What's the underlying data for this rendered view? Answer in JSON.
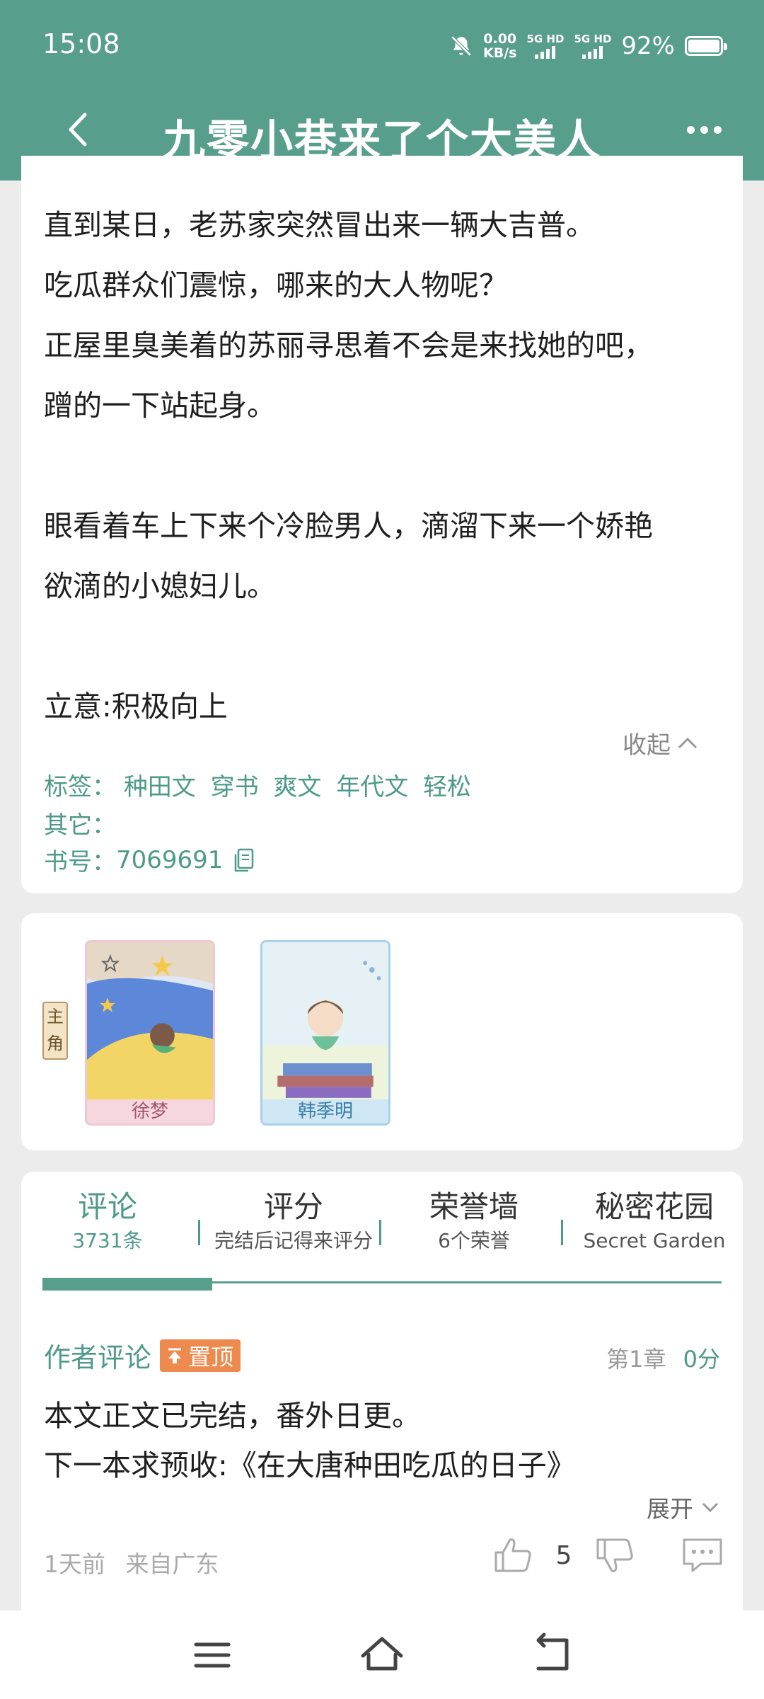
{
  "status_bar": {
    "time": "15:08",
    "net_speed_value": "0.00",
    "net_speed_unit": "KB/s",
    "sim1_label": "5G HD",
    "sim2_label": "5G HD",
    "battery": "92%"
  },
  "header": {
    "title": "九零小巷来了个大美人",
    "back_icon": "chevron-left-icon",
    "more_icon": "more-dots-icon"
  },
  "intro": {
    "lines": [
      "直到某日，老苏家突然冒出来一辆大吉普。",
      "吃瓜群众们震惊，哪来的大人物呢？",
      "正屋里臭美着的苏丽寻思着不会是来找她的吧，",
      "蹭的一下站起身。",
      "",
      "眼看着车上下来个冷脸男人，滴溜下来一个娇艳",
      "欲滴的小媳妇儿。",
      "",
      "立意:积极向上"
    ],
    "collapse_label": "收起",
    "tags_label": "标签：",
    "tags": [
      "种田文",
      "穿书",
      "爽文",
      "年代文",
      "轻松"
    ],
    "other_label": "其它：",
    "book_id_label": "书号：",
    "book_id": "7069691"
  },
  "roles": {
    "label": "主角",
    "characters": [
      {
        "name": "徐梦"
      },
      {
        "name": "韩季明"
      }
    ]
  },
  "comments": {
    "tabs": [
      {
        "title": "评论",
        "subtitle": "3731条"
      },
      {
        "title": "评分",
        "subtitle": "完结后记得来评分"
      },
      {
        "title": "荣誉墙",
        "subtitle": "6个荣誉"
      },
      {
        "title": "秘密花园",
        "subtitle": "Secret Garden"
      }
    ],
    "pinned": {
      "author_label": "作者评论",
      "pin_label": "置顶",
      "chapter": "第1章",
      "score": "0分",
      "lines": [
        "本文正文已完结，番外日更。",
        "下一本求预收:《在大唐种田吃瓜的日子》"
      ],
      "expand_label": "展开",
      "time": "1天前",
      "location": "来自广东",
      "likes": "5"
    }
  },
  "colors": {
    "brand": "#579e8d",
    "accent_text": "#4e9a8a",
    "pin_badge": "#ef8a4e"
  }
}
